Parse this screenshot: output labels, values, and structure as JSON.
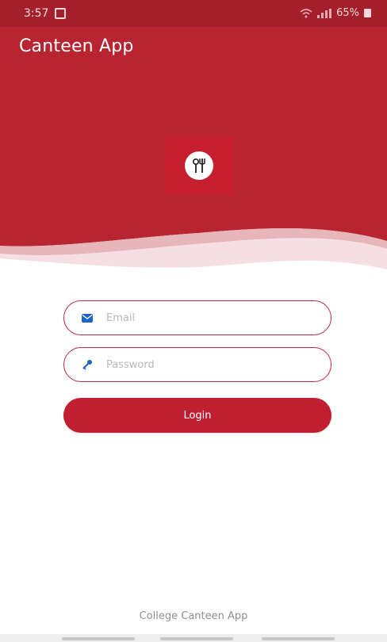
{
  "status_bar": {
    "time": "3:57",
    "battery": "65%",
    "icons": [
      "notification-icon",
      "wifi-icon",
      "signal-icon",
      "battery-icon"
    ]
  },
  "app_bar": {
    "title": "Canteen App"
  },
  "hero": {
    "logo_icon": "utensils-icon"
  },
  "login_form": {
    "email": {
      "placeholder": "Email",
      "value": "",
      "icon": "email-icon"
    },
    "password": {
      "placeholder": "Password",
      "value": "",
      "icon": "key-icon"
    },
    "login_label": "Login"
  },
  "footer": {
    "text": "College Canteen App"
  },
  "colors": {
    "primary": "#b8242f",
    "status_bar": "#a31f2b",
    "button": "#c01f32",
    "field_border": "#c0253a",
    "icon_blue": "#1f63c8"
  }
}
